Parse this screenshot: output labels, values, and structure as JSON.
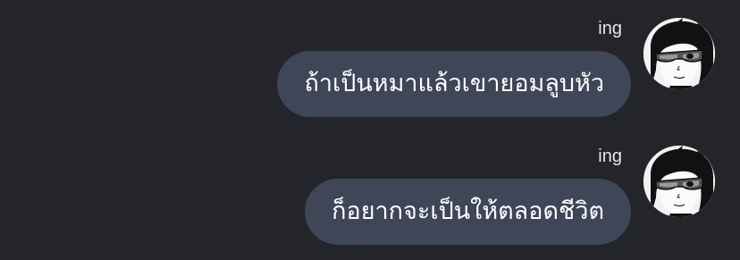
{
  "chat": {
    "messages": [
      {
        "sender": "ing",
        "text": "ถ้าเป็นหมาแล้วเขายอมลูบหัว",
        "avatar_icon": "anime-character-avatar-icon"
      },
      {
        "sender": "ing",
        "text": "ก็อยากจะเป็นให้ตลอดชีวิต",
        "avatar_icon": "anime-character-avatar-icon"
      }
    ]
  },
  "colors": {
    "background": "#23252b",
    "bubble": "#3e4657",
    "bubble_text": "#ffffff",
    "sender_text": "#e6e7ea"
  }
}
